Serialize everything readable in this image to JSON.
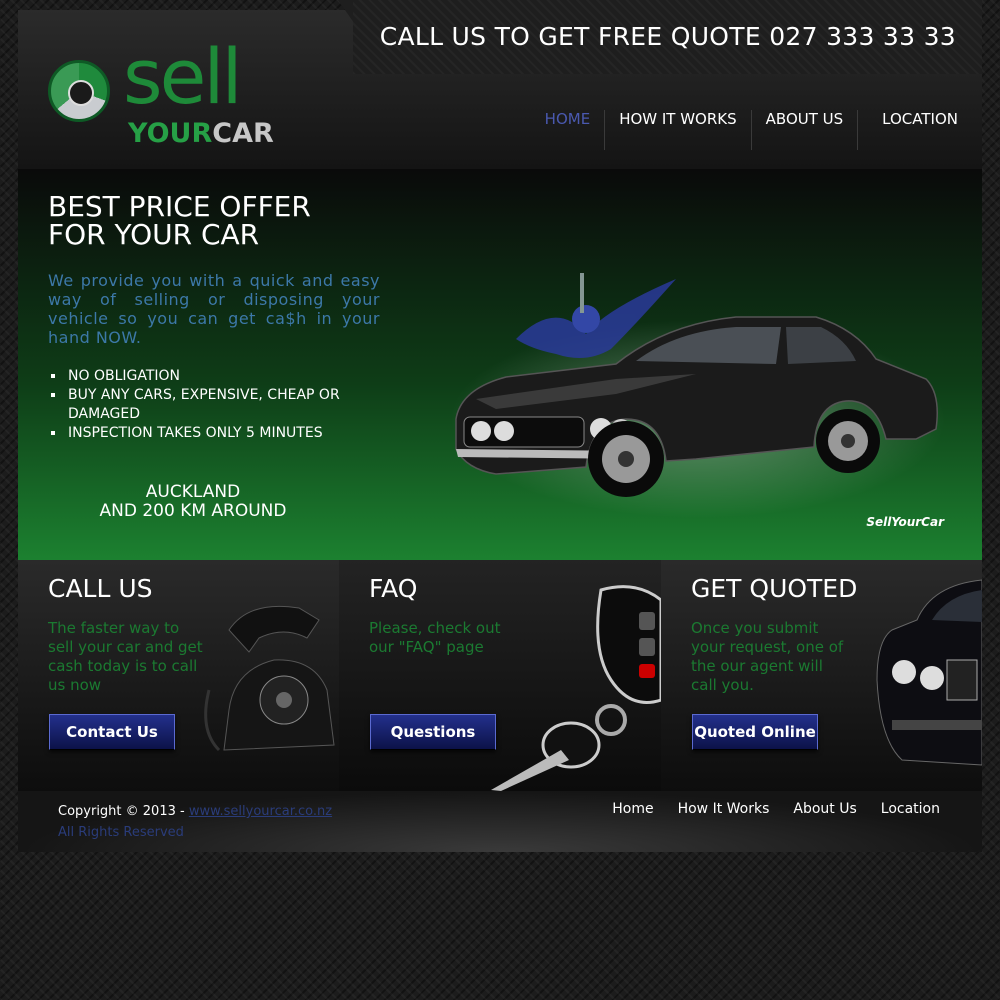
{
  "header": {
    "call_line": "CALL US TO GET FREE QUOTE 027 333 33 33",
    "logo": {
      "word1": "sell",
      "word2a": "YOUR",
      "word2b": "CAR"
    },
    "nav": [
      {
        "label": "HOME",
        "active": true
      },
      {
        "label": "HOW IT WORKS",
        "active": false
      },
      {
        "label": "ABOUT US",
        "active": false
      },
      {
        "label": "LOCATION",
        "active": false
      }
    ]
  },
  "hero": {
    "title_line1": "BEST PRICE OFFER",
    "title_line2": "FOR YOUR CAR",
    "description": "We provide you with a quick and easy way of selling or disposing your vehicle so you can get ca$h in your hand NOW.",
    "bullets": [
      "NO OBLIGATION",
      "BUY ANY CARS, EXPENSIVE, CHEAP OR DAMAGED",
      "INSPECTION TAKES ONLY 5 MINUTES"
    ],
    "area_line1": "AUCKLAND",
    "area_line2": "AND 200 KM AROUND",
    "brand_tag": "SellYourCar"
  },
  "features": [
    {
      "title": "CALL US",
      "text": "The faster way to sell your car and get cash today is to call us now",
      "button": "Contact Us"
    },
    {
      "title": "FAQ",
      "text": "Please, check out our \"FAQ\" page",
      "button": "Questions"
    },
    {
      "title": "GET QUOTED",
      "text": "Once you submit your request, one of the our agent will call you.",
      "button": "Quoted Online"
    }
  ],
  "footer": {
    "copyright": "Copyright © 2013 - ",
    "site_link": "www.sellyourcar.co.nz",
    "rights": "All Rights Reserved",
    "nav": [
      "Home",
      "How It Works",
      "About Us",
      "Location"
    ]
  },
  "colors": {
    "brand_green": "#1e8a39",
    "nav_active": "#4a59b0",
    "button_blue": "#1a2577",
    "hero_text_blue": "#3c78a8"
  }
}
